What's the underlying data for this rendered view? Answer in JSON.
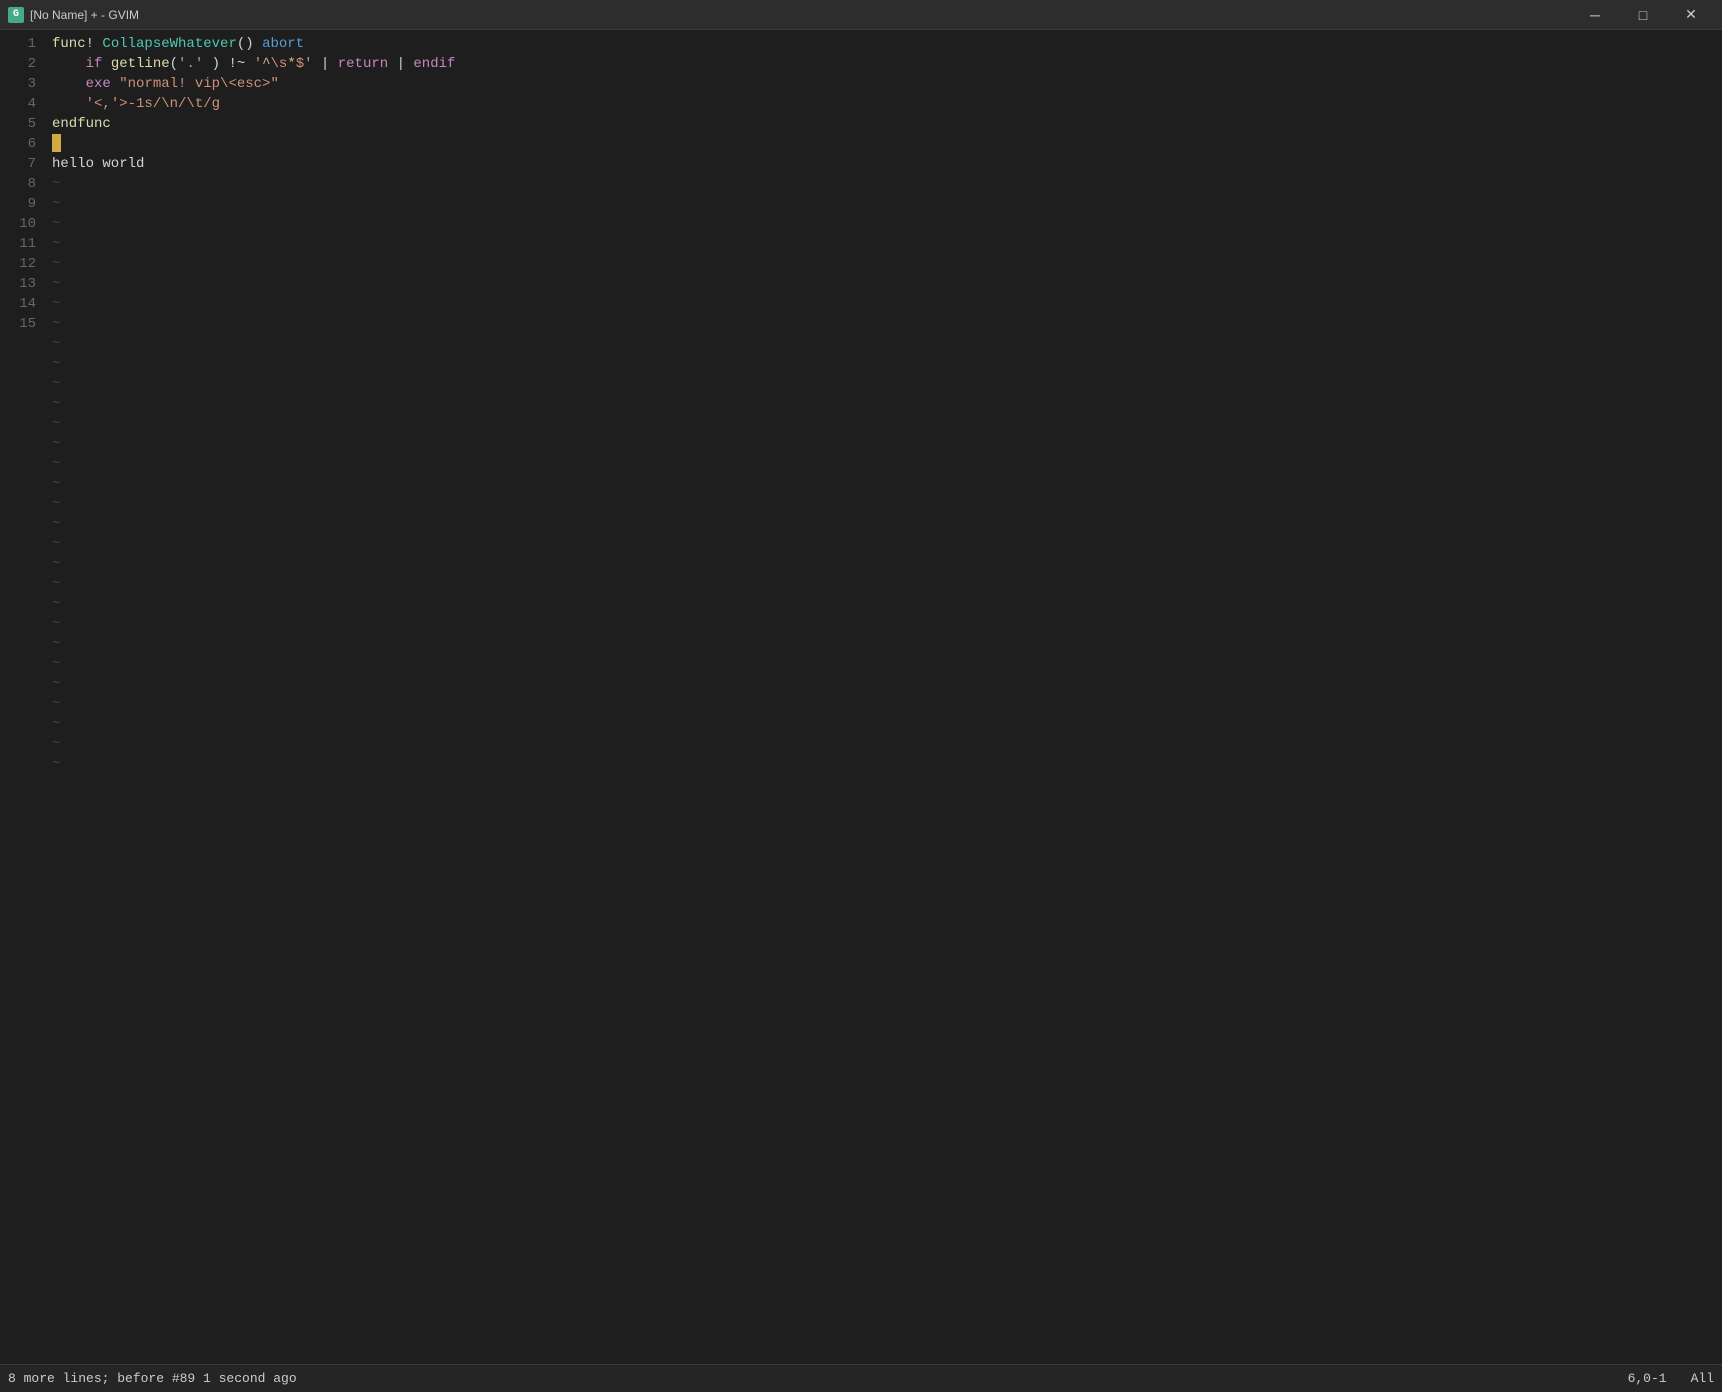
{
  "titlebar": {
    "icon_text": "G",
    "title": "[No Name] + - GVIM",
    "minimize_label": "─",
    "maximize_label": "□",
    "close_label": "✕"
  },
  "code": {
    "lines": [
      {
        "num": "1",
        "content": "func! CollapseWhatever() abort",
        "type": "code"
      },
      {
        "num": "2",
        "content": "    if getline('.') !~ '^\\s*$' | return | endif",
        "type": "code"
      },
      {
        "num": "3",
        "content": "    exe \"normal! vip\\<esc>\"",
        "type": "code"
      },
      {
        "num": "4",
        "content": "    '<,'>-1s/\\n/\\t/g",
        "type": "code"
      },
      {
        "num": "5",
        "content": "endfunc",
        "type": "code"
      },
      {
        "num": "6",
        "content": "",
        "type": "cursor"
      },
      {
        "num": "7",
        "content": "",
        "type": "empty"
      },
      {
        "num": "8",
        "content": "",
        "type": "empty"
      },
      {
        "num": "9",
        "content": "",
        "type": "empty"
      },
      {
        "num": "10",
        "content": "",
        "type": "empty"
      },
      {
        "num": "11",
        "content": "",
        "type": "empty"
      },
      {
        "num": "12",
        "content": "",
        "type": "empty"
      },
      {
        "num": "13",
        "content": "",
        "type": "empty"
      },
      {
        "num": "14",
        "content": "",
        "type": "empty"
      },
      {
        "num": "15",
        "content": "hello world",
        "type": "code"
      }
    ],
    "tilde_count": 30
  },
  "statusbar": {
    "left": "8 more lines; before #89  1 second ago",
    "position": "6,0-1",
    "scroll": "All"
  }
}
